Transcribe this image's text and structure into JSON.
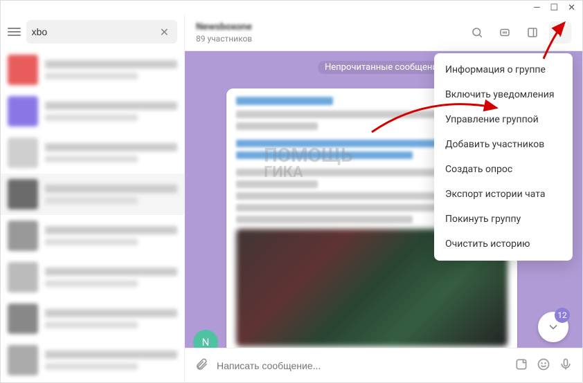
{
  "window": {
    "minimize": "—",
    "maximize": "☐",
    "close": "✕"
  },
  "search": {
    "value": "xbo",
    "clear": "✕"
  },
  "chats": [
    {
      "avatar_color": "#e85c5c"
    },
    {
      "avatar_color": "#8b76e6"
    },
    {
      "avatar_color": "#cfcfcf"
    },
    {
      "avatar_color": "#6b6b6b"
    },
    {
      "avatar_color": "#999"
    },
    {
      "avatar_color": "#bbb"
    },
    {
      "avatar_color": "#888"
    },
    {
      "avatar_color": "#aaa"
    }
  ],
  "chat": {
    "title": "Newsboxone",
    "subtitle": "89 участников",
    "unread_label": "Непрочитанные сообщения",
    "scroll_badge": "12",
    "avatar_letter": "N"
  },
  "composer": {
    "placeholder": "Написать сообщение..."
  },
  "menu": {
    "items": [
      "Информация о группе",
      "Включить уведомления",
      "Управление группой",
      "Добавить участников",
      "Создать опрос",
      "Экспорт истории чата",
      "Покинуть группу",
      "Очистить историю"
    ]
  },
  "watermark": {
    "line1": "ПОМОЩЬ",
    "line2": "ГИКА"
  },
  "colors": {
    "chat_bg": "#b09bd6",
    "accent": "#8d7fd8",
    "arrow": "#d40000"
  }
}
